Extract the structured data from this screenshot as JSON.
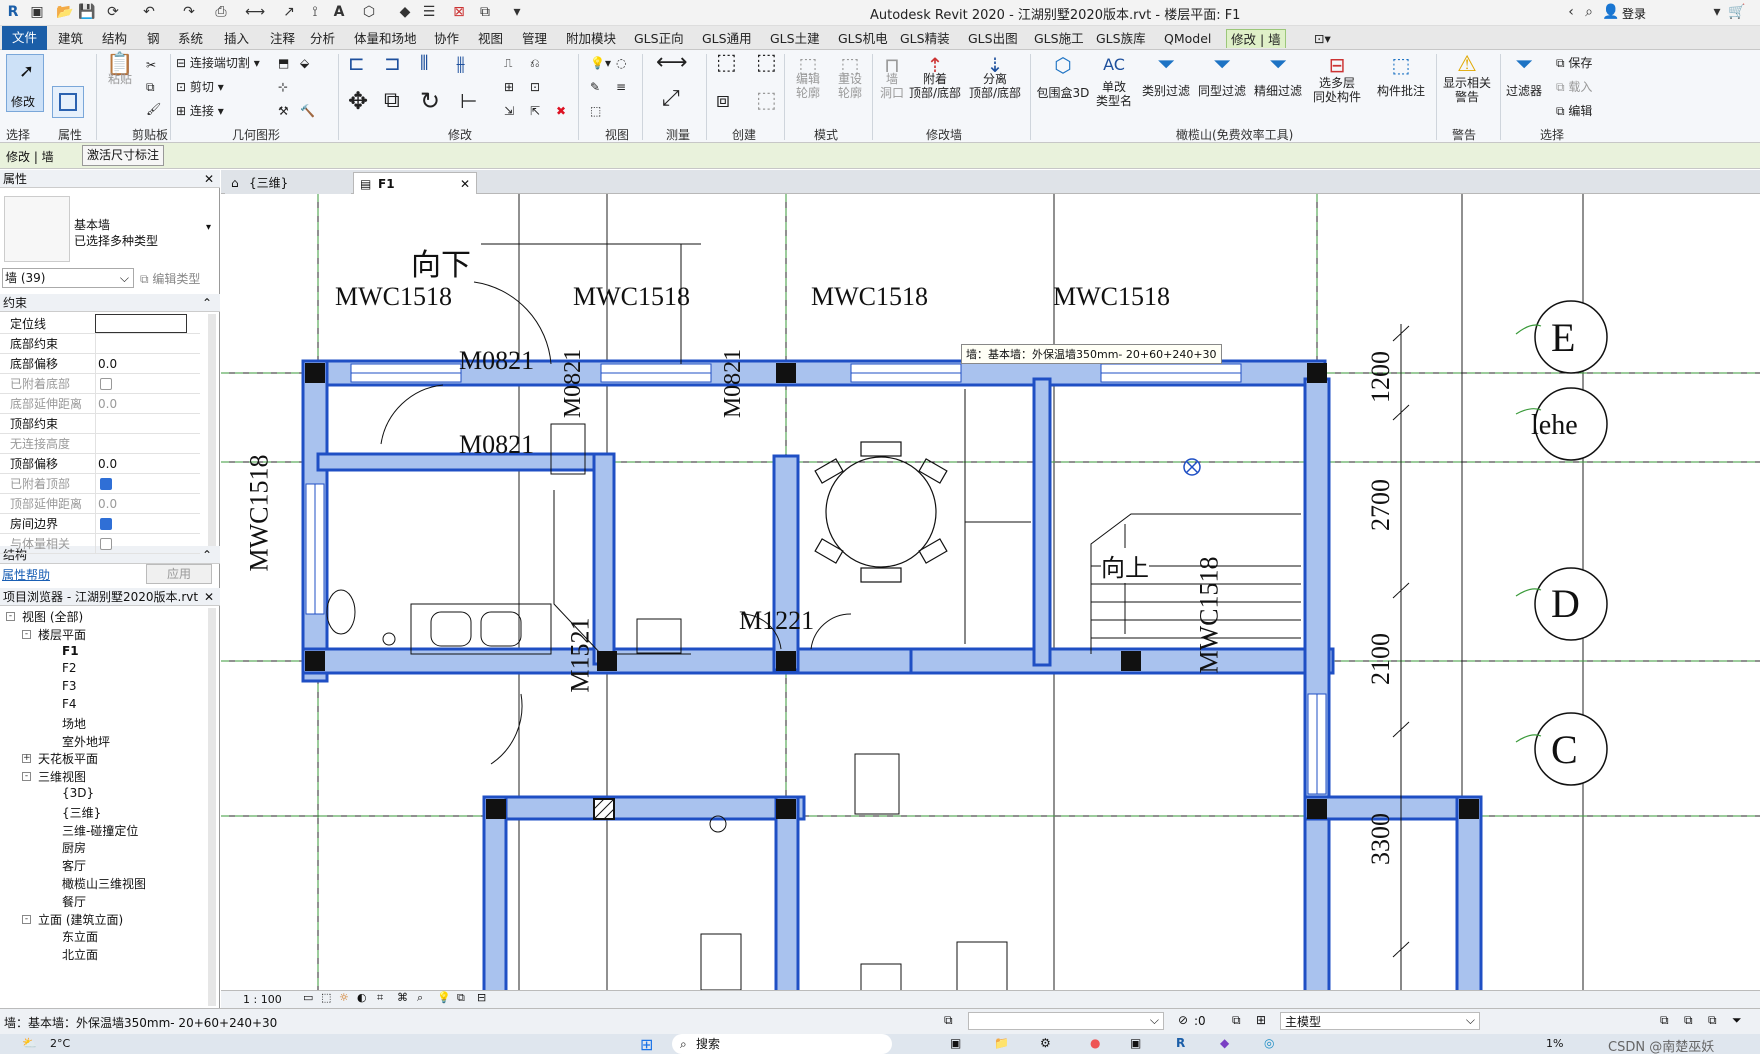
{
  "title": "Autodesk Revit 2020 - 江湖别墅2020版本.rvt - 楼层平面: F1",
  "titlebar": {
    "login": "登录"
  },
  "ribbon_tabs": [
    "文件",
    "建筑",
    "结构",
    "钢",
    "系统",
    "插入",
    "注释",
    "分析",
    "体量和场地",
    "协作",
    "视图",
    "管理",
    "附加模块",
    "GLS正向",
    "GLS通用",
    "GLS土建",
    "GLS机电",
    "GLS精装",
    "GLS出图",
    "GLS施工",
    "GLS族库",
    "QModel",
    "修改 | 墙"
  ],
  "ribbon": {
    "select": {
      "modify": "修改",
      "label": "选择"
    },
    "properties_label": "属性",
    "clipboard": {
      "paste": "粘贴",
      "label": "剪贴板"
    },
    "geometry": {
      "join_cut": "连接端切割",
      "cut": "剪切",
      "join": "连接",
      "label": "几何图形"
    },
    "modify_label": "修改",
    "view_label": "视图",
    "measure_label": "测量",
    "create_label": "创建",
    "mode": {
      "edit_profile": "编辑\n轮廓",
      "reset_profile": "重设\n轮廓",
      "label": "模式"
    },
    "modify_wall": {
      "wall_opening": "墙\n洞口",
      "attach": "附着\n顶部/底部",
      "detach": "分离\n顶部/底部",
      "label": "修改墙"
    },
    "gls": {
      "box3d": "包围盒3D",
      "rename": "单改\n类型名",
      "filter_type": "类别过滤",
      "filter_same": "同型过滤",
      "filter_fine": "精细过滤",
      "multi_layer": "选多层\n同处构件",
      "annotate": "构件批注",
      "label": "橄榄山(免费效率工具)"
    },
    "warning": {
      "show": "显示相关\n警告",
      "label": "警告"
    },
    "selection": {
      "filter": "过滤器",
      "save": "保存",
      "load": "载入",
      "edit": "编辑",
      "label": "选择"
    }
  },
  "ctxbar": {
    "mode": "修改 | 墙",
    "dims": "激活尺寸标注"
  },
  "properties": {
    "title": "属性",
    "type_name": "基本墙",
    "type_sub": "已选择多种类型",
    "selector": "墙 (39)",
    "edit_type": "编辑类型",
    "section_constraints": "约束",
    "rows": [
      {
        "label": "定位线",
        "value": "",
        "type": "box",
        "disabled": false
      },
      {
        "label": "底部约束",
        "value": "",
        "type": "text",
        "disabled": false
      },
      {
        "label": "底部偏移",
        "value": "0.0",
        "type": "text",
        "disabled": false
      },
      {
        "label": "已附着底部",
        "value": "",
        "type": "check",
        "checked": false,
        "disabled": true
      },
      {
        "label": "底部延伸距离",
        "value": "0.0",
        "type": "text",
        "disabled": true
      },
      {
        "label": "顶部约束",
        "value": "",
        "type": "text",
        "disabled": false
      },
      {
        "label": "无连接高度",
        "value": "",
        "type": "text",
        "disabled": true
      },
      {
        "label": "顶部偏移",
        "value": "0.0",
        "type": "text",
        "disabled": false
      },
      {
        "label": "已附着顶部",
        "value": "",
        "type": "check",
        "checked": true,
        "disabled": true
      },
      {
        "label": "顶部延伸距离",
        "value": "0.0",
        "type": "text",
        "disabled": true
      },
      {
        "label": "房间边界",
        "value": "",
        "type": "check",
        "checked": true,
        "disabled": false
      },
      {
        "label": "与体量相关",
        "value": "",
        "type": "check",
        "checked": false,
        "disabled": true
      }
    ],
    "section_structure": "结构",
    "help": "属性帮助",
    "apply": "应用"
  },
  "browser": {
    "title": "项目浏览器 - 江湖别墅2020版本.rvt",
    "items": [
      {
        "text": "视图 (全部)",
        "level": 0,
        "toggle": "-"
      },
      {
        "text": "楼层平面",
        "level": 1,
        "toggle": "-"
      },
      {
        "text": "F1",
        "level": 2,
        "bold": true
      },
      {
        "text": "F2",
        "level": 2
      },
      {
        "text": "F3",
        "level": 2
      },
      {
        "text": "F4",
        "level": 2
      },
      {
        "text": "场地",
        "level": 2
      },
      {
        "text": "室外地坪",
        "level": 2
      },
      {
        "text": "天花板平面",
        "level": 1,
        "toggle": "+"
      },
      {
        "text": "三维视图",
        "level": 1,
        "toggle": "-"
      },
      {
        "text": "{3D}",
        "level": 2
      },
      {
        "text": "{三维}",
        "level": 2
      },
      {
        "text": "三维-碰撞定位",
        "level": 2
      },
      {
        "text": "厨房",
        "level": 2
      },
      {
        "text": "客厅",
        "level": 2
      },
      {
        "text": "橄榄山三维视图",
        "level": 2
      },
      {
        "text": "餐厅",
        "level": 2
      },
      {
        "text": "立面 (建筑立面)",
        "level": 1,
        "toggle": "-"
      },
      {
        "text": "东立面",
        "level": 2
      },
      {
        "text": "北立面",
        "level": 2
      }
    ]
  },
  "view_tabs": [
    {
      "label": "{三维}",
      "active": false
    },
    {
      "label": "F1",
      "active": true
    }
  ],
  "drawing": {
    "windows": [
      "MWC1518",
      "MWC1518",
      "MWC1518",
      "MWC1518"
    ],
    "left_window": "MWC1518",
    "right_window": "MWC1518",
    "doors": [
      "M0821",
      "M0821",
      "M0821",
      "M0821",
      "M1521",
      "M1221"
    ],
    "down_text": "向下",
    "up_text": "向上",
    "tooltip": "墙：基本墙：外保温墙350mm- 20+60+240+30",
    "dims": [
      "1200",
      "2700",
      "2100",
      "3300"
    ],
    "grid_bubbles": [
      "E",
      "lehe",
      "D",
      "C"
    ],
    "wall_color": "#1f4fc4",
    "wall_fill": "#a9c2ee"
  },
  "viewbar": {
    "scale": "1 : 100"
  },
  "statusbar": {
    "text": "墙：基本墙：外保温墙350mm- 20+60+240+30",
    "zero": ":0",
    "model": "主模型"
  },
  "taskbar": {
    "temp": "2°C",
    "search": "搜索",
    "watermark": "CSDN @南楚巫妖",
    "percent": "1%"
  }
}
